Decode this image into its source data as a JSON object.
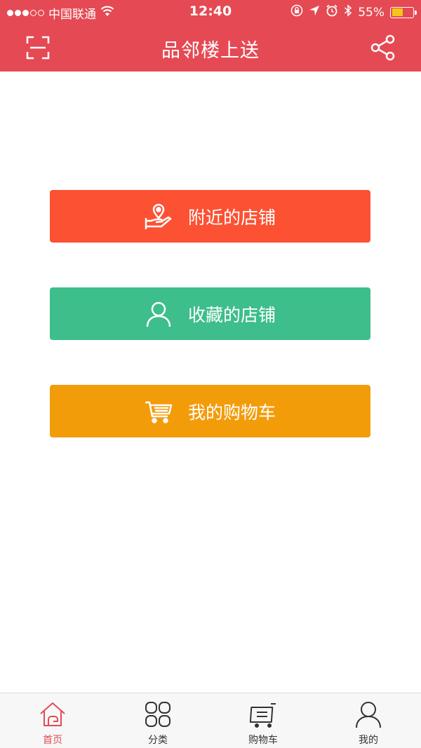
{
  "status_bar": {
    "carrier": "中国联通",
    "time": "12:40",
    "battery_percent": "55%",
    "battery_level": 0.55,
    "icons": [
      "signal-dots-icon",
      "wifi-icon",
      "orientation-lock-icon",
      "location-arrow-icon",
      "alarm-icon",
      "bluetooth-icon",
      "battery-icon"
    ]
  },
  "nav": {
    "title": "品邻楼上送",
    "left_icon": "scan-icon",
    "right_icon": "share-icon"
  },
  "menu": [
    {
      "label": "附近的店铺",
      "icon": "location-hand-icon",
      "color": "#fc5133"
    },
    {
      "label": "收藏的店铺",
      "icon": "user-icon",
      "color": "#3dbe8b"
    },
    {
      "label": "我的购物车",
      "icon": "cart-icon",
      "color": "#f39c0a"
    }
  ],
  "tabs": [
    {
      "label": "首页",
      "icon": "home-icon",
      "active": true
    },
    {
      "label": "分类",
      "icon": "category-grid-icon",
      "active": false
    },
    {
      "label": "购物车",
      "icon": "cart-icon",
      "active": false
    },
    {
      "label": "我的",
      "icon": "user-icon",
      "active": false
    }
  ],
  "colors": {
    "header": "#e54a54",
    "accent_active": "#e54a54",
    "battery": "#f5c518"
  }
}
